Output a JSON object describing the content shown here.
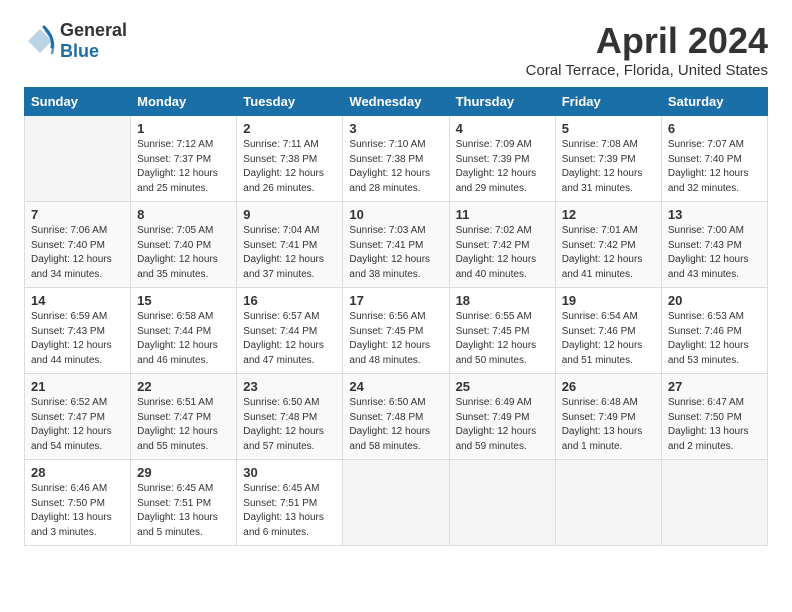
{
  "header": {
    "logo_general": "General",
    "logo_blue": "Blue",
    "title": "April 2024",
    "subtitle": "Coral Terrace, Florida, United States"
  },
  "calendar": {
    "days_of_week": [
      "Sunday",
      "Monday",
      "Tuesday",
      "Wednesday",
      "Thursday",
      "Friday",
      "Saturday"
    ],
    "weeks": [
      [
        {
          "num": "",
          "info": ""
        },
        {
          "num": "1",
          "info": "Sunrise: 7:12 AM\nSunset: 7:37 PM\nDaylight: 12 hours\nand 25 minutes."
        },
        {
          "num": "2",
          "info": "Sunrise: 7:11 AM\nSunset: 7:38 PM\nDaylight: 12 hours\nand 26 minutes."
        },
        {
          "num": "3",
          "info": "Sunrise: 7:10 AM\nSunset: 7:38 PM\nDaylight: 12 hours\nand 28 minutes."
        },
        {
          "num": "4",
          "info": "Sunrise: 7:09 AM\nSunset: 7:39 PM\nDaylight: 12 hours\nand 29 minutes."
        },
        {
          "num": "5",
          "info": "Sunrise: 7:08 AM\nSunset: 7:39 PM\nDaylight: 12 hours\nand 31 minutes."
        },
        {
          "num": "6",
          "info": "Sunrise: 7:07 AM\nSunset: 7:40 PM\nDaylight: 12 hours\nand 32 minutes."
        }
      ],
      [
        {
          "num": "7",
          "info": "Sunrise: 7:06 AM\nSunset: 7:40 PM\nDaylight: 12 hours\nand 34 minutes."
        },
        {
          "num": "8",
          "info": "Sunrise: 7:05 AM\nSunset: 7:40 PM\nDaylight: 12 hours\nand 35 minutes."
        },
        {
          "num": "9",
          "info": "Sunrise: 7:04 AM\nSunset: 7:41 PM\nDaylight: 12 hours\nand 37 minutes."
        },
        {
          "num": "10",
          "info": "Sunrise: 7:03 AM\nSunset: 7:41 PM\nDaylight: 12 hours\nand 38 minutes."
        },
        {
          "num": "11",
          "info": "Sunrise: 7:02 AM\nSunset: 7:42 PM\nDaylight: 12 hours\nand 40 minutes."
        },
        {
          "num": "12",
          "info": "Sunrise: 7:01 AM\nSunset: 7:42 PM\nDaylight: 12 hours\nand 41 minutes."
        },
        {
          "num": "13",
          "info": "Sunrise: 7:00 AM\nSunset: 7:43 PM\nDaylight: 12 hours\nand 43 minutes."
        }
      ],
      [
        {
          "num": "14",
          "info": "Sunrise: 6:59 AM\nSunset: 7:43 PM\nDaylight: 12 hours\nand 44 minutes."
        },
        {
          "num": "15",
          "info": "Sunrise: 6:58 AM\nSunset: 7:44 PM\nDaylight: 12 hours\nand 46 minutes."
        },
        {
          "num": "16",
          "info": "Sunrise: 6:57 AM\nSunset: 7:44 PM\nDaylight: 12 hours\nand 47 minutes."
        },
        {
          "num": "17",
          "info": "Sunrise: 6:56 AM\nSunset: 7:45 PM\nDaylight: 12 hours\nand 48 minutes."
        },
        {
          "num": "18",
          "info": "Sunrise: 6:55 AM\nSunset: 7:45 PM\nDaylight: 12 hours\nand 50 minutes."
        },
        {
          "num": "19",
          "info": "Sunrise: 6:54 AM\nSunset: 7:46 PM\nDaylight: 12 hours\nand 51 minutes."
        },
        {
          "num": "20",
          "info": "Sunrise: 6:53 AM\nSunset: 7:46 PM\nDaylight: 12 hours\nand 53 minutes."
        }
      ],
      [
        {
          "num": "21",
          "info": "Sunrise: 6:52 AM\nSunset: 7:47 PM\nDaylight: 12 hours\nand 54 minutes."
        },
        {
          "num": "22",
          "info": "Sunrise: 6:51 AM\nSunset: 7:47 PM\nDaylight: 12 hours\nand 55 minutes."
        },
        {
          "num": "23",
          "info": "Sunrise: 6:50 AM\nSunset: 7:48 PM\nDaylight: 12 hours\nand 57 minutes."
        },
        {
          "num": "24",
          "info": "Sunrise: 6:50 AM\nSunset: 7:48 PM\nDaylight: 12 hours\nand 58 minutes."
        },
        {
          "num": "25",
          "info": "Sunrise: 6:49 AM\nSunset: 7:49 PM\nDaylight: 12 hours\nand 59 minutes."
        },
        {
          "num": "26",
          "info": "Sunrise: 6:48 AM\nSunset: 7:49 PM\nDaylight: 13 hours\nand 1 minute."
        },
        {
          "num": "27",
          "info": "Sunrise: 6:47 AM\nSunset: 7:50 PM\nDaylight: 13 hours\nand 2 minutes."
        }
      ],
      [
        {
          "num": "28",
          "info": "Sunrise: 6:46 AM\nSunset: 7:50 PM\nDaylight: 13 hours\nand 3 minutes."
        },
        {
          "num": "29",
          "info": "Sunrise: 6:45 AM\nSunset: 7:51 PM\nDaylight: 13 hours\nand 5 minutes."
        },
        {
          "num": "30",
          "info": "Sunrise: 6:45 AM\nSunset: 7:51 PM\nDaylight: 13 hours\nand 6 minutes."
        },
        {
          "num": "",
          "info": ""
        },
        {
          "num": "",
          "info": ""
        },
        {
          "num": "",
          "info": ""
        },
        {
          "num": "",
          "info": ""
        }
      ]
    ]
  }
}
